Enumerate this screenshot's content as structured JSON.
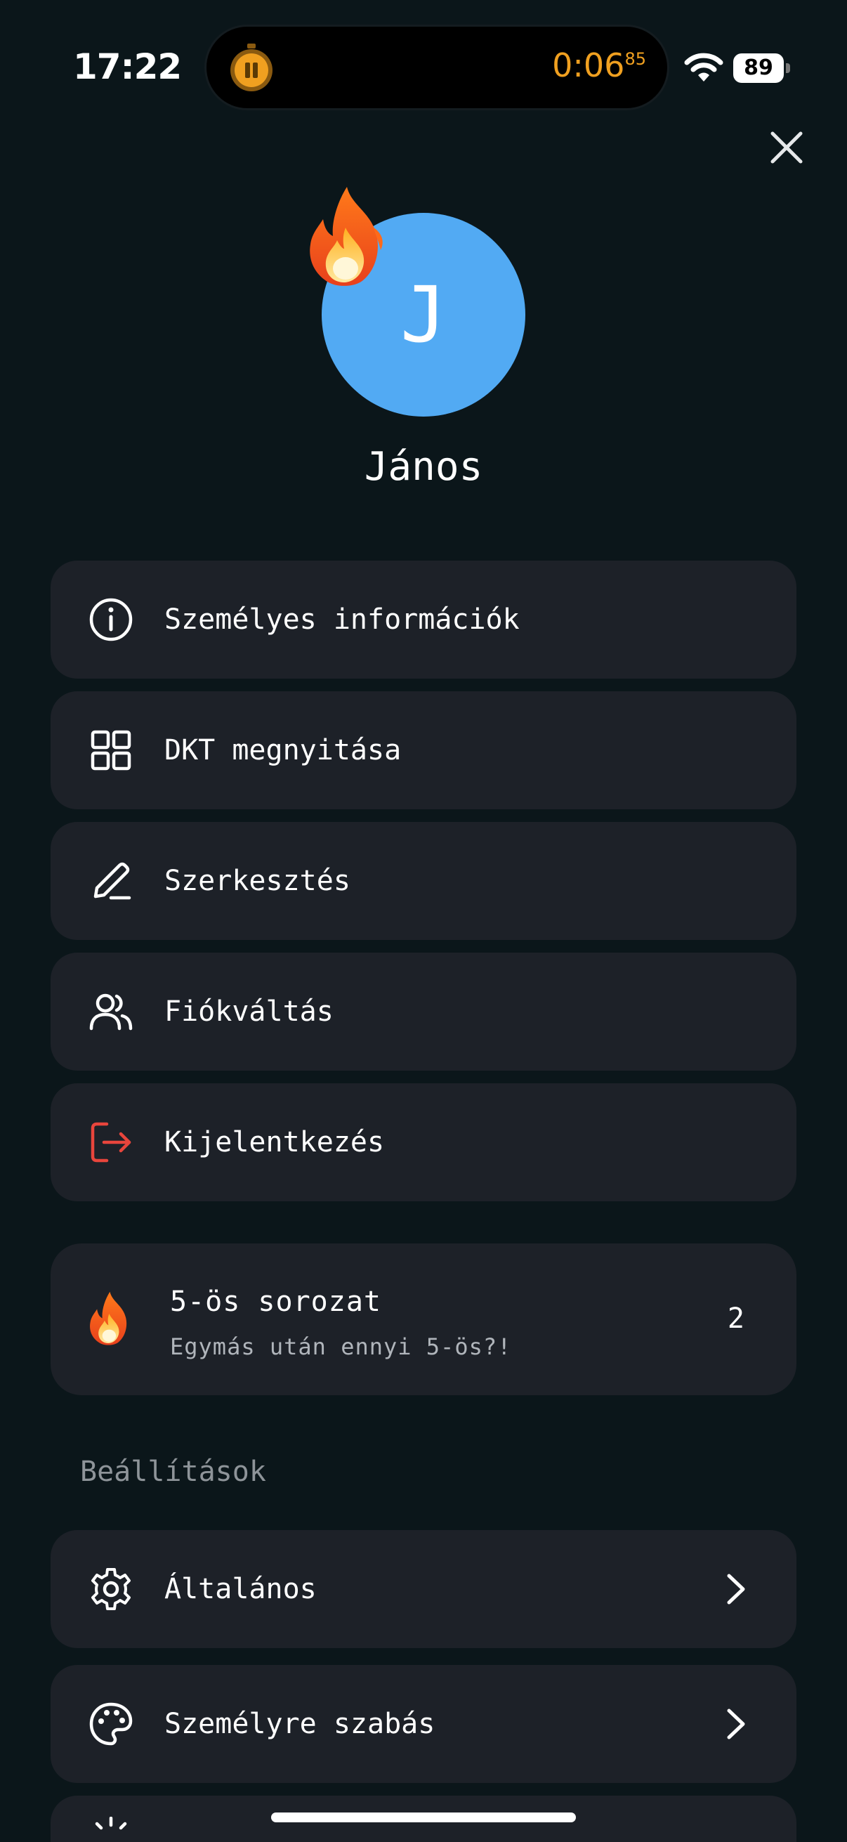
{
  "status_bar": {
    "time": "17:22",
    "timer_main": "0:06",
    "timer_fraction": "85",
    "battery": "89"
  },
  "profile": {
    "initial": "J",
    "name": "János"
  },
  "menu": {
    "items": [
      {
        "label": "Személyes információk",
        "icon": "info-icon"
      },
      {
        "label": "DKT megnyitása",
        "icon": "grid-icon"
      },
      {
        "label": "Szerkesztés",
        "icon": "pencil-icon"
      },
      {
        "label": "Fiókváltás",
        "icon": "users-icon"
      },
      {
        "label": "Kijelentkezés",
        "icon": "logout-icon"
      }
    ]
  },
  "streak": {
    "title": "5-ös sorozat",
    "subtitle": "Egymás után ennyi 5-ös?!",
    "count": "2",
    "icon": "flame-icon"
  },
  "settings": {
    "section_title": "Beállítások",
    "items": [
      {
        "label": "Általános",
        "icon": "gear-icon"
      },
      {
        "label": "Személyre szabás",
        "icon": "palette-icon"
      }
    ]
  },
  "colors": {
    "background": "#0b161a",
    "card": "#1d2128",
    "avatar": "#52aaf3",
    "logout_accent": "#e8453c",
    "timer_accent": "#f0a020"
  }
}
